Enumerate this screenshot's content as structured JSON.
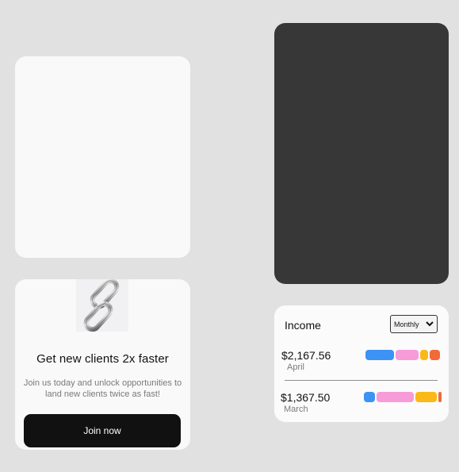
{
  "colors": {
    "blue": "#3d93f5",
    "pink": "#f79bd9",
    "yellow": "#fbb918",
    "orange": "#f16a3a",
    "dark_card": "#373737",
    "button": "#111111"
  },
  "promo": {
    "icon": "chain-link-icon",
    "title": "Get new clients 2x faster",
    "body": "Join us today and unlock opportunities to land new clients twice as fast!",
    "button_label": "Join now"
  },
  "income": {
    "title": "Income",
    "period": {
      "selected": "Monthly"
    },
    "rows": [
      {
        "amount": "$2,167.56",
        "month": "April",
        "segments": [
          {
            "color": "blue",
            "share": 0.34
          },
          {
            "color": "pink",
            "share": 0.28
          },
          {
            "color": "yellow",
            "share": 0.1
          },
          {
            "color": "orange",
            "share": 0.12
          }
        ]
      },
      {
        "amount": "$1,367.50",
        "month": "March",
        "segments": [
          {
            "color": "blue",
            "share": 0.14
          },
          {
            "color": "pink",
            "share": 0.48
          },
          {
            "color": "yellow",
            "share": 0.27
          },
          {
            "color": "orange",
            "share": 0.04
          }
        ]
      }
    ]
  }
}
